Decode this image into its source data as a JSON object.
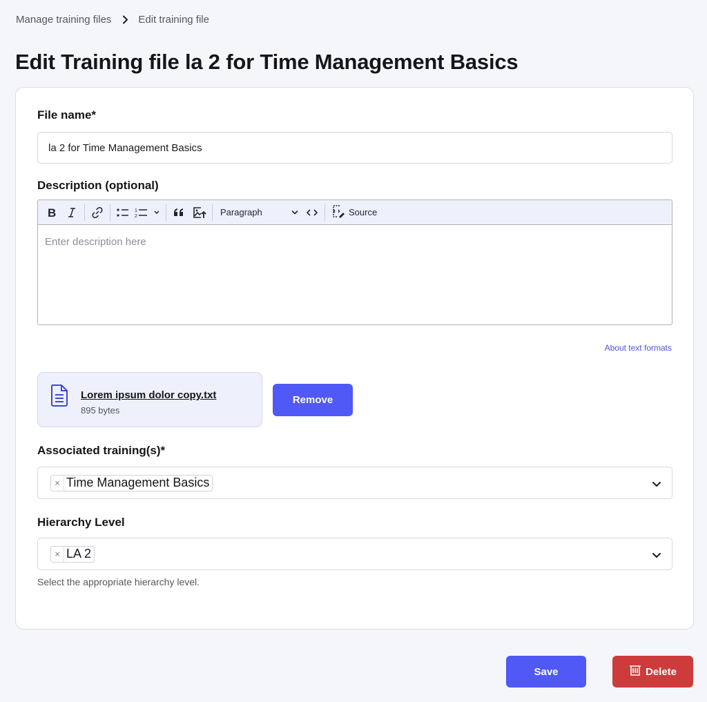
{
  "breadcrumb": {
    "items": [
      "Manage training files",
      "Edit training file"
    ],
    "separator_icon": "chevron-right-icon"
  },
  "page": {
    "title": "Edit Training file la 2 for Time Management Basics"
  },
  "form": {
    "file_name": {
      "label": "File name*",
      "value": "la 2 for Time Management Basics"
    },
    "description": {
      "label": "Description (optional)",
      "placeholder": "Enter description here",
      "toolbar": {
        "buttons": [
          "bold-icon",
          "italic-icon",
          "link-icon",
          "bulleted-list-icon",
          "numbered-list-icon",
          "blockquote-icon",
          "image-upload-icon",
          "code-icon",
          "source-icon"
        ],
        "heading_select": "Paragraph",
        "source_label": "Source"
      },
      "about_link": "About text formats"
    },
    "attachment": {
      "file_name": "Lorem ipsum dolor copy.txt",
      "file_size": "895 bytes",
      "icon": "document-icon",
      "remove_label": "Remove"
    },
    "trainings": {
      "label": "Associated training(s)*",
      "selected": [
        "Time Management Basics"
      ]
    },
    "hierarchy": {
      "label": "Hierarchy Level",
      "selected": [
        "LA 2"
      ],
      "help": "Select the appropriate hierarchy level."
    }
  },
  "actions": {
    "save_label": "Save",
    "delete_label": "Delete",
    "delete_icon": "trash-icon"
  },
  "colors": {
    "primary": "#5058f5",
    "danger": "#cd3b3b",
    "background": "#f5f6f9",
    "toolbar_bg": "#eef0fb",
    "link": "#4a55d8"
  },
  "chip_remove_glyph": "×"
}
